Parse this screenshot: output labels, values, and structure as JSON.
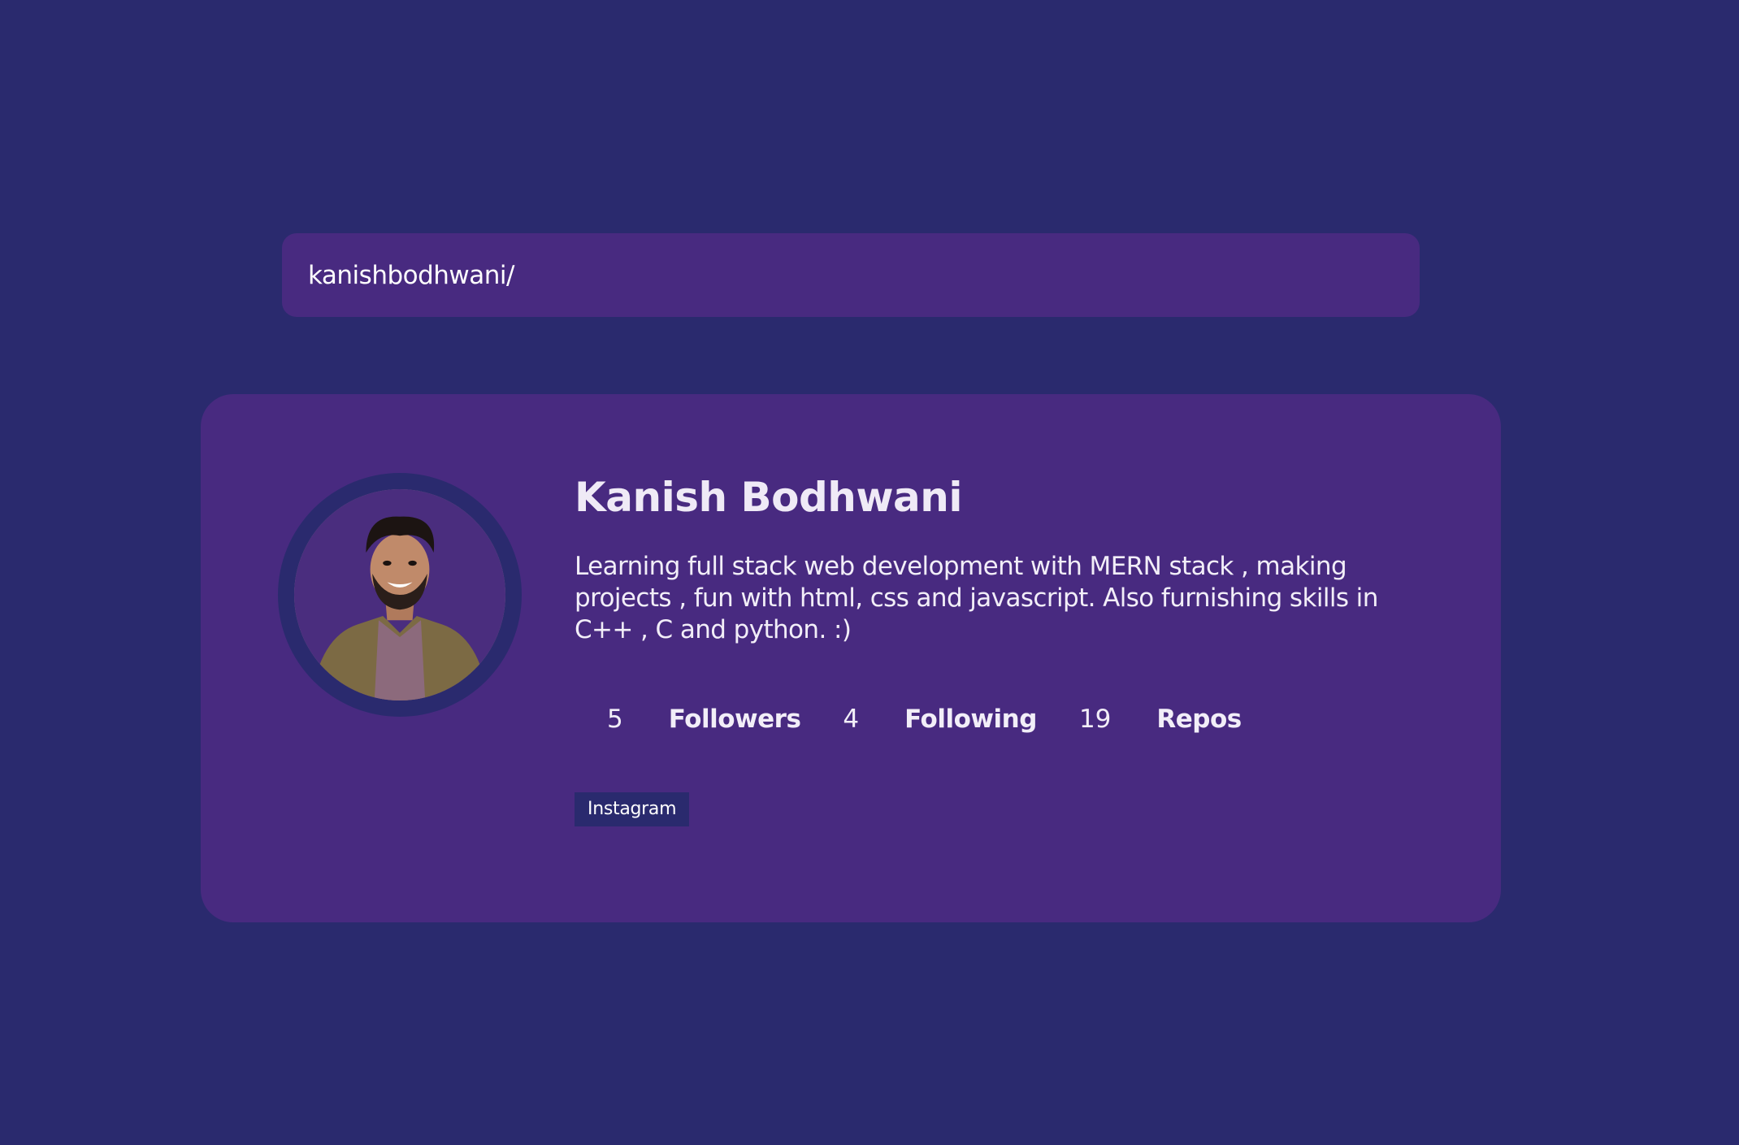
{
  "search": {
    "value": "kanishbodhwani/",
    "placeholder": ""
  },
  "profile": {
    "name": "Kanish Bodhwani",
    "bio": "Learning full stack web development with MERN stack , making projects , fun with html, css and javascript. Also furnishing skills in C++ , C and python. :)",
    "followers_count": "5",
    "followers_label": "Followers",
    "following_count": "4",
    "following_label": "Following",
    "repos_count": "19",
    "repos_label": "Repos",
    "links": [
      "Instagram"
    ]
  },
  "colors": {
    "background": "#2a2a6e",
    "card": "#482a80",
    "text": "#eeeaf4",
    "tag": "#2a2a6e"
  }
}
